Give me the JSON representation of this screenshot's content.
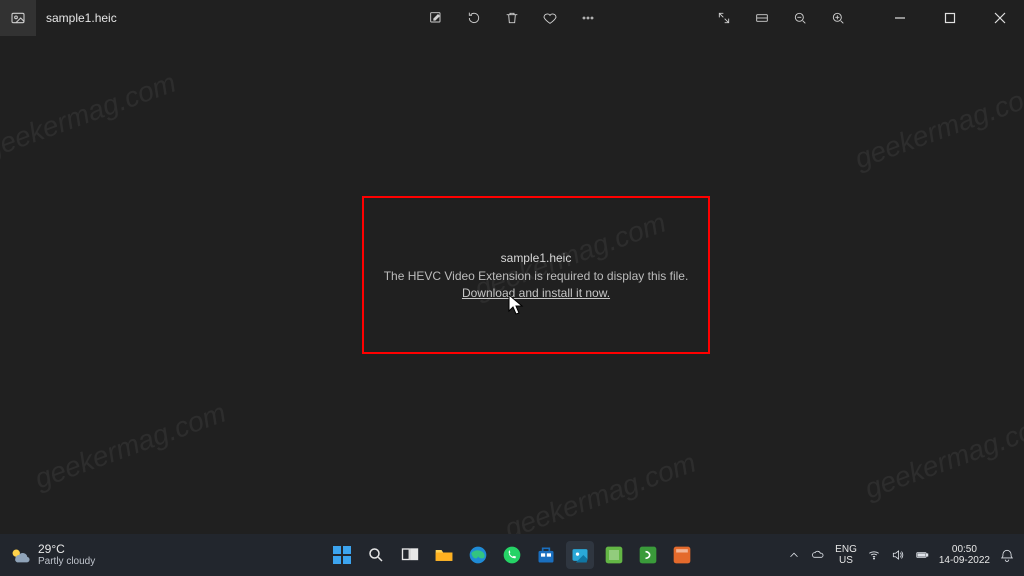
{
  "title": {
    "filename": "sample1.heic"
  },
  "toolbar": {
    "edit": "Edit",
    "rotate": "Rotate",
    "delete": "Delete",
    "favorite": "Favorite",
    "more": "See more"
  },
  "viewbar": {
    "fullscreen": "Full screen",
    "filmstrip": "Film strip",
    "zoom_out": "Zoom out",
    "zoom_in": "Zoom in"
  },
  "window_controls": {
    "minimize": "Minimize",
    "maximize": "Maximize",
    "close": "Close"
  },
  "error": {
    "filename": "sample1.heic",
    "message": "The HEVC Video Extension is required to display this file.",
    "link": "Download and install it now."
  },
  "watermark": "geekermag.com",
  "taskbar": {
    "weather": {
      "temp": "29°C",
      "condition": "Partly cloudy"
    },
    "tray": {
      "lang1": "ENG",
      "lang2": "US",
      "time": "00:50",
      "date": "14-09-2022"
    }
  }
}
